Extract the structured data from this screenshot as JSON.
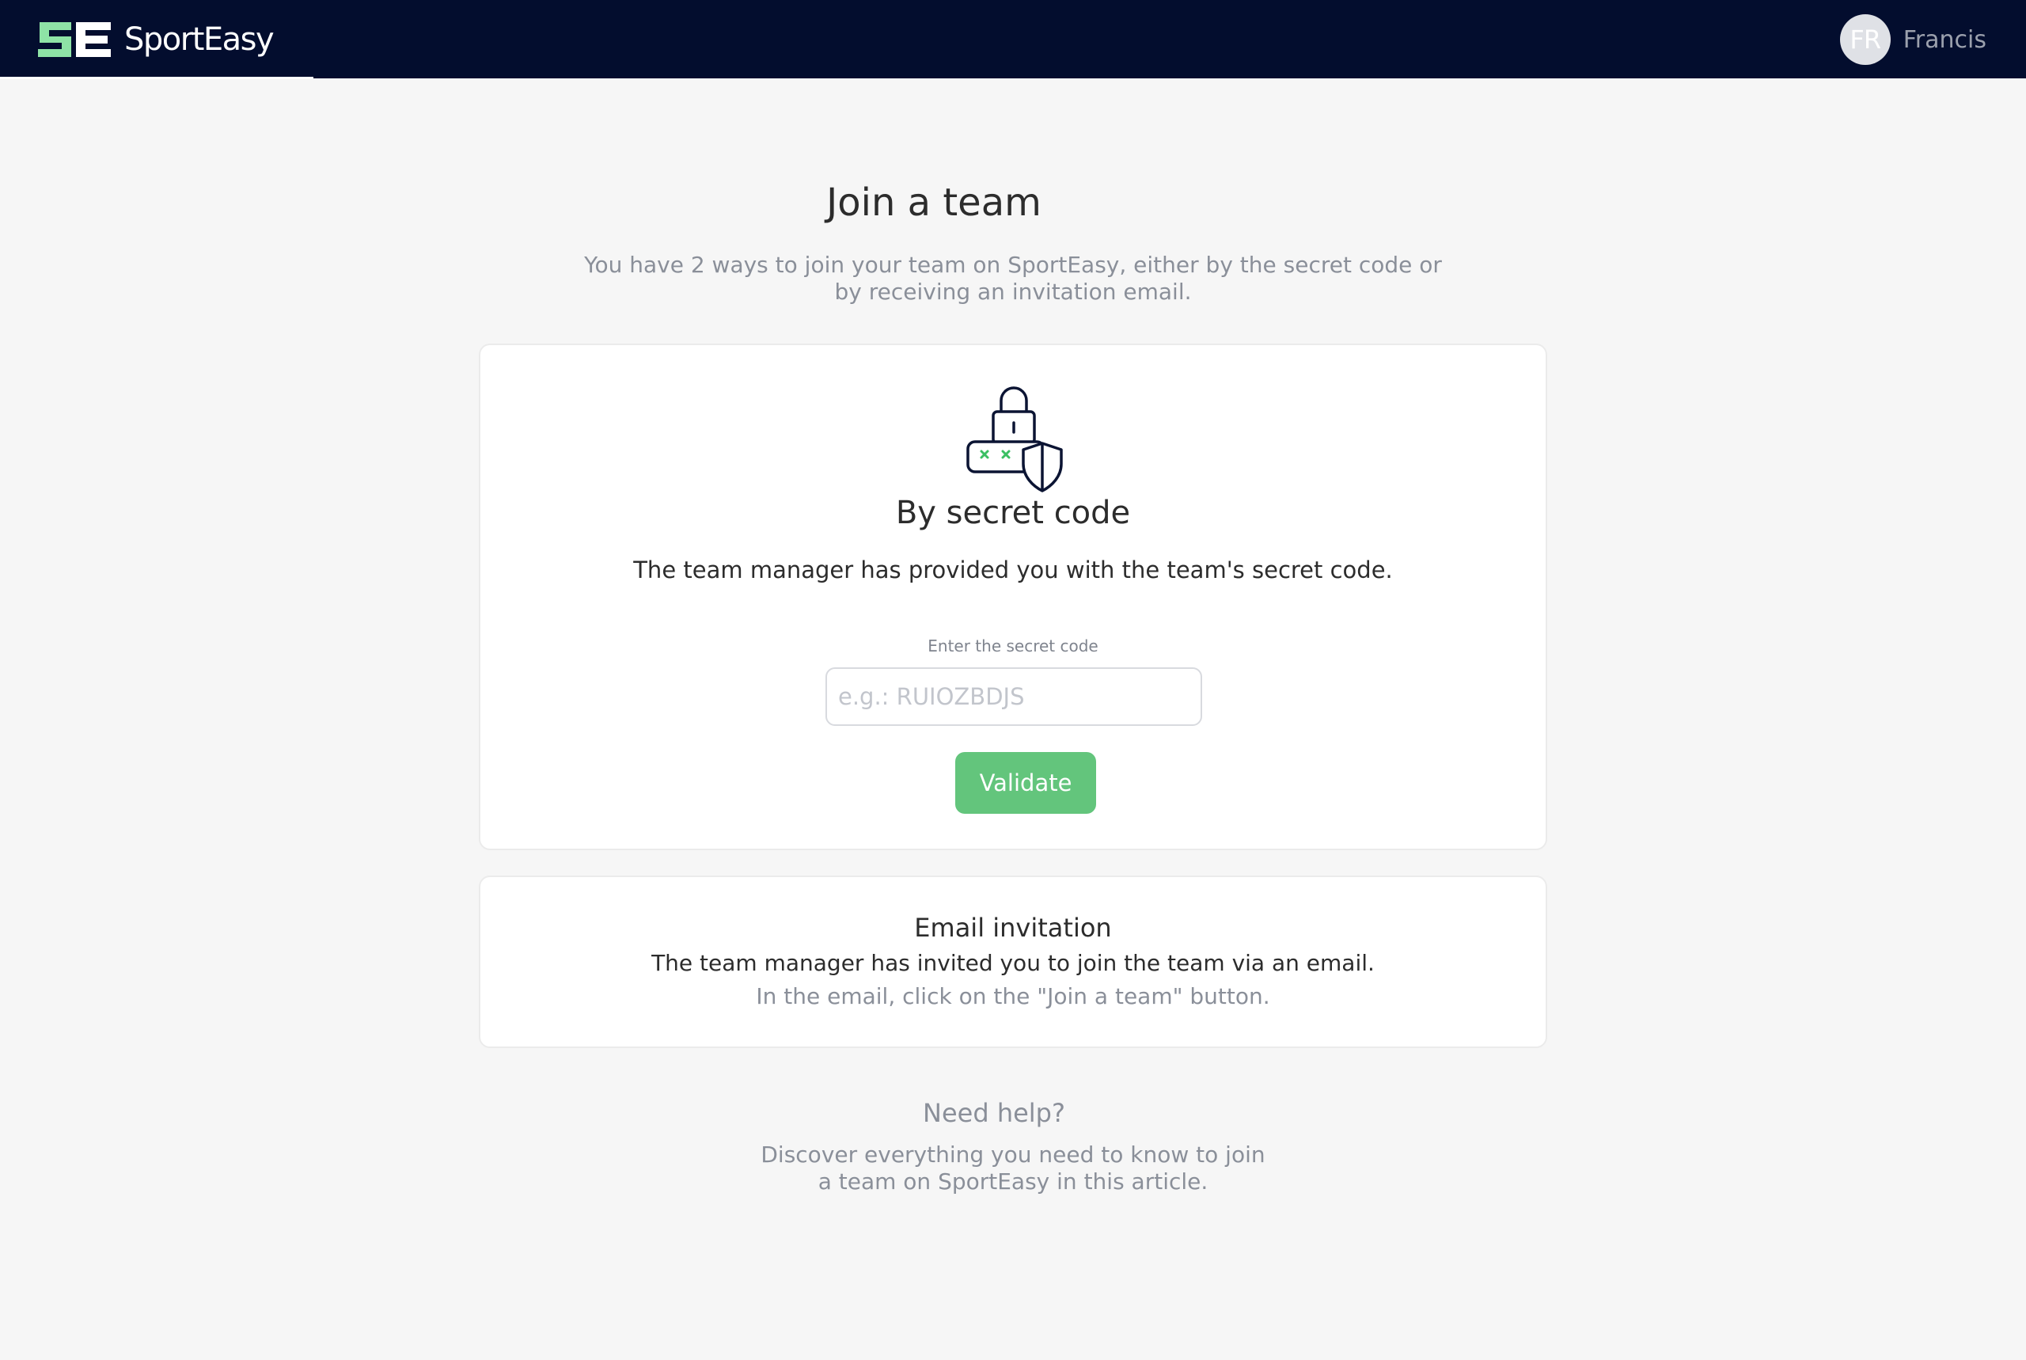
{
  "header": {
    "brand_name": "SportEasy",
    "logo_mark": "SE",
    "user": {
      "initials": "FR",
      "name": "Francis"
    }
  },
  "main": {
    "title": "Join a team",
    "subtitle": "You have 2 ways to join your team on SportEasy, either by the secret code or by receiving an invitation email.",
    "secret_code_card": {
      "illustration": "lock-password-shield-icon",
      "title": "By secret code",
      "description": "The team manager has provided you with the team's secret code.",
      "field_label": "Enter the secret code",
      "input_value": "",
      "input_placeholder": "e.g.: RUIOZBDJS",
      "validate_label": "Validate"
    },
    "email_card": {
      "title": "Email invitation",
      "description": "The team manager has invited you to join the team via an email.",
      "hint": "In the email, click on the \"Join a team\" button."
    },
    "help": {
      "title": "Need help?",
      "description": "Discover everything you need to know to join a team on SportEasy in this article."
    }
  },
  "colors": {
    "header_background": "#030d2e",
    "page_background": "#f6f6f6",
    "accent_green": "#63c57c",
    "logo_green": "#8ee3a6",
    "muted_text": "#8a8f99"
  }
}
